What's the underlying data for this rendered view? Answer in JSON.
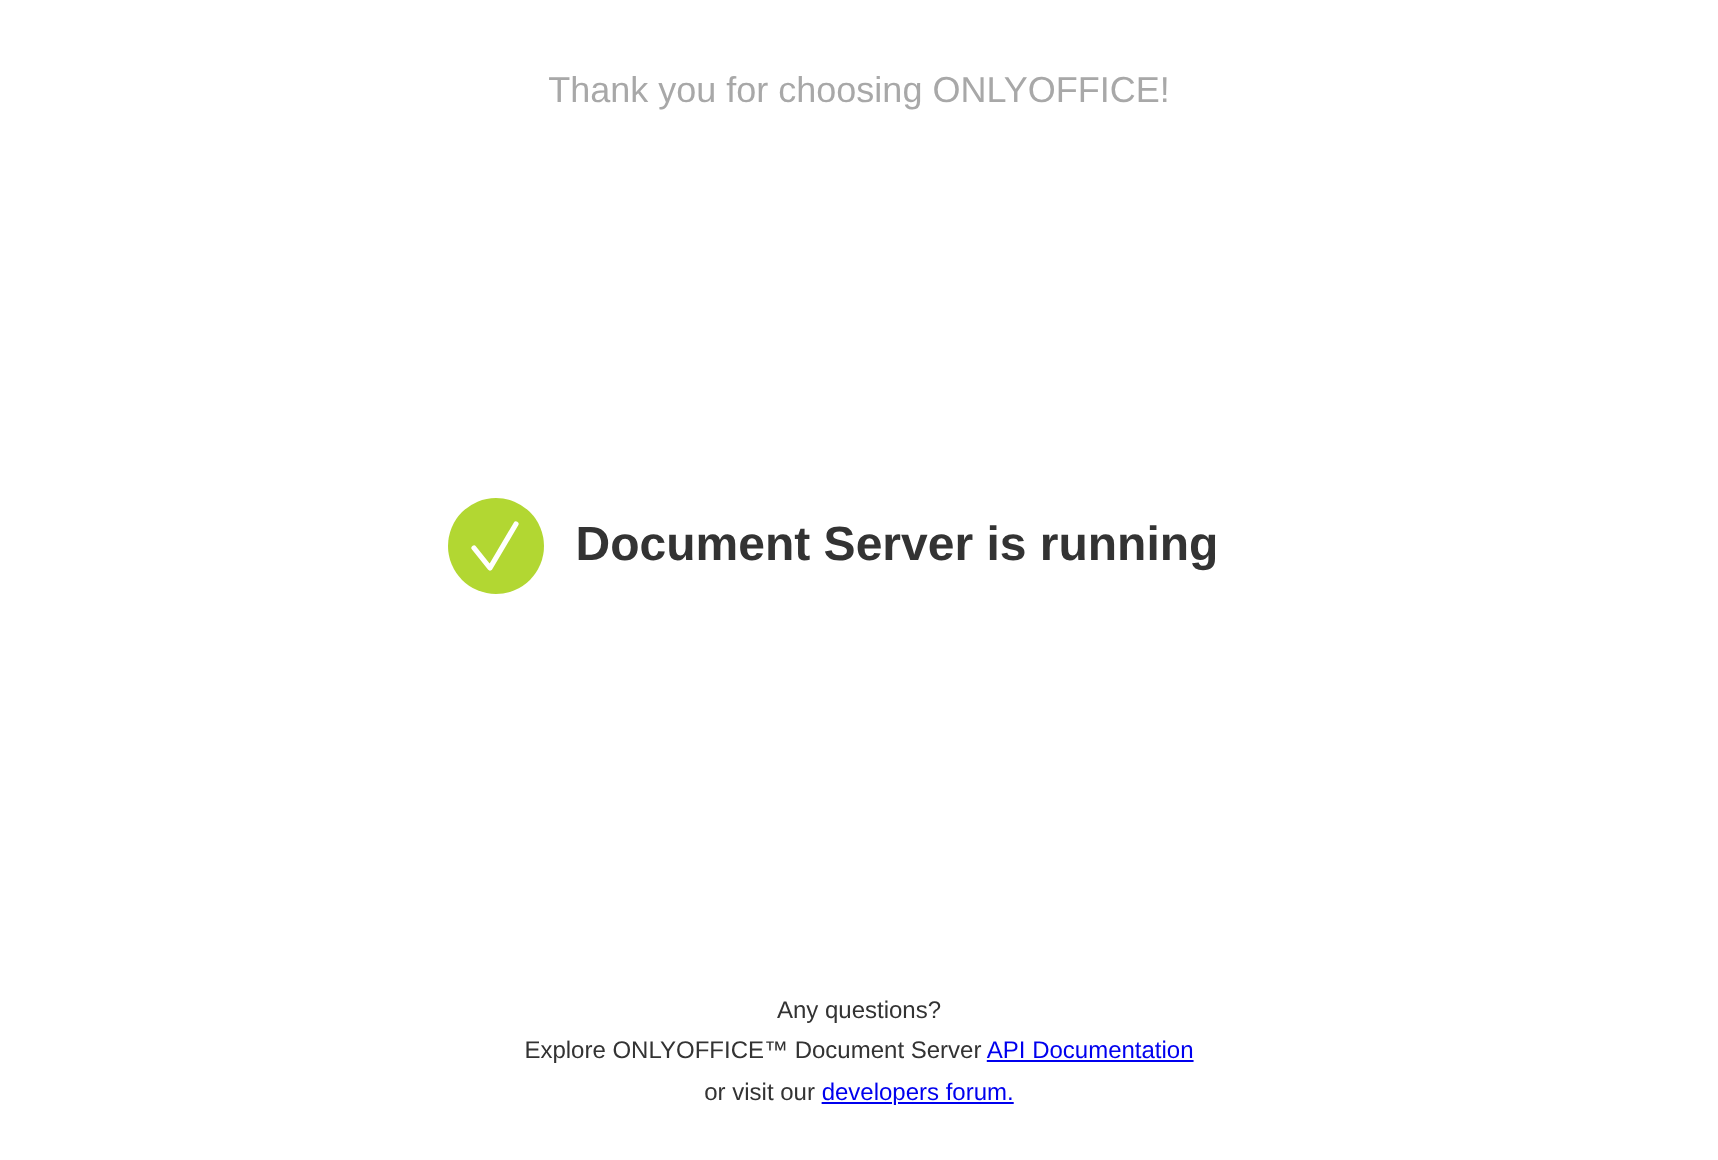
{
  "header": {
    "title": "Thank you for choosing ONLYOFFICE!"
  },
  "status": {
    "kind": "success",
    "text": "Document Server is running"
  },
  "footer": {
    "lines": [
      {
        "text": "Any questions?"
      },
      {
        "text": "Explore ONLYOFFICE™ Document Server ",
        "link": "API Documentation"
      },
      {
        "text": "or visit our ",
        "link": "developers forum."
      }
    ]
  }
}
